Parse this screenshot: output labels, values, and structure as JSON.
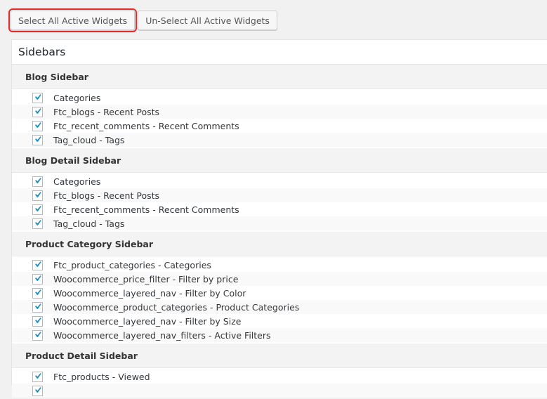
{
  "toolbar": {
    "select_all_label": "Select All Active Widgets",
    "unselect_all_label": "Un-Select All Active Widgets"
  },
  "panel": {
    "title": "Sidebars"
  },
  "groups": [
    {
      "title": "Blog Sidebar",
      "items": [
        {
          "label": "Categories",
          "checked": true
        },
        {
          "label": "Ftc_blogs - Recent Posts",
          "checked": true
        },
        {
          "label": "Ftc_recent_comments - Recent Comments",
          "checked": true
        },
        {
          "label": "Tag_cloud - Tags",
          "checked": true
        }
      ]
    },
    {
      "title": "Blog Detail Sidebar",
      "items": [
        {
          "label": "Categories",
          "checked": true
        },
        {
          "label": "Ftc_blogs - Recent Posts",
          "checked": true
        },
        {
          "label": "Ftc_recent_comments - Recent Comments",
          "checked": true
        },
        {
          "label": "Tag_cloud - Tags",
          "checked": true
        }
      ]
    },
    {
      "title": "Product Category Sidebar",
      "items": [
        {
          "label": "Ftc_product_categories - Categories",
          "checked": true
        },
        {
          "label": "Woocommerce_price_filter - Filter by price",
          "checked": true
        },
        {
          "label": "Woocommerce_layered_nav - Filter by Color",
          "checked": true
        },
        {
          "label": "Woocommerce_product_categories - Product Categories",
          "checked": true
        },
        {
          "label": "Woocommerce_layered_nav - Filter by Size",
          "checked": true
        },
        {
          "label": "Woocommerce_layered_nav_filters - Active Filters",
          "checked": true
        }
      ]
    },
    {
      "title": "Product Detail Sidebar",
      "items": [
        {
          "label": "Ftc_products - Viewed",
          "checked": true
        },
        {
          "label": "",
          "checked": true
        }
      ]
    }
  ],
  "colors": {
    "check": "#1e8cbe",
    "highlight_border": "#e32b2b"
  }
}
